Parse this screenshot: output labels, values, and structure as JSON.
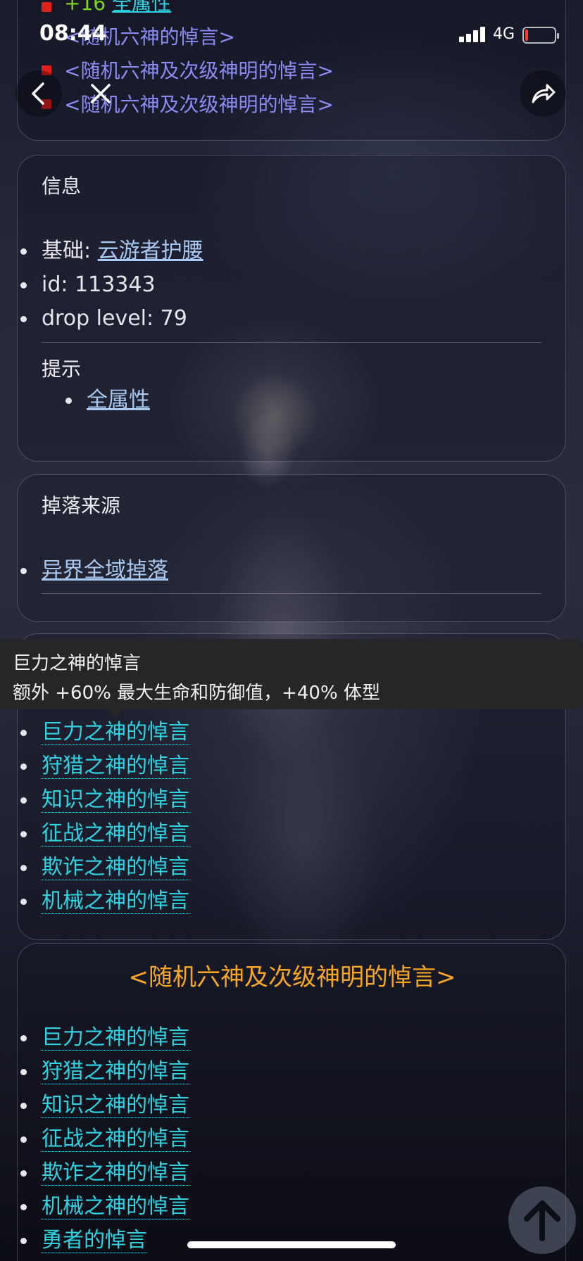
{
  "status_bar": {
    "time": "08:44",
    "network": "4G"
  },
  "top_partial": {
    "row0_value": "+16",
    "row0_link": "全属性",
    "row1": "<随机六神的悼言>",
    "row2": "<随机六神及次级神明的悼言>",
    "row3": "<随机六神及次级神明的悼言>"
  },
  "info_card": {
    "title": "信息",
    "base_label": "基础: ",
    "base_link": "云游者护腰",
    "id_line": "id: 113343",
    "drop_line": "drop level: 79",
    "hint_title": "提示",
    "hint_link": "全属性"
  },
  "drop_card": {
    "title": "掉落来源",
    "link": "异界全域掉落"
  },
  "tooltip": {
    "title": "巨力之神的悼言",
    "desc": "额外 +60% 最大生命和防御值，+40% 体型"
  },
  "gods_card_1": {
    "items": [
      "巨力之神的悼言",
      "狩猎之神的悼言",
      "知识之神的悼言",
      "征战之神的悼言",
      "欺诈之神的悼言",
      "机械之神的悼言"
    ]
  },
  "gods_card_2": {
    "heading": "<随机六神及次级神明的悼言>",
    "items": [
      "巨力之神的悼言",
      "狩猎之神的悼言",
      "知识之神的悼言",
      "征战之神的悼言",
      "欺诈之神的悼言",
      "机械之神的悼言",
      "勇者的悼言"
    ]
  },
  "colors": {
    "heading": "#f5a623",
    "god_link": "#2fd2e0",
    "purple_text": "#8c8cf5",
    "plus_value": "#7ed321"
  },
  "icons": {
    "back": "chevron-left-icon",
    "close": "close-icon",
    "share": "share-icon",
    "scroll_top": "arrow-up-icon"
  }
}
